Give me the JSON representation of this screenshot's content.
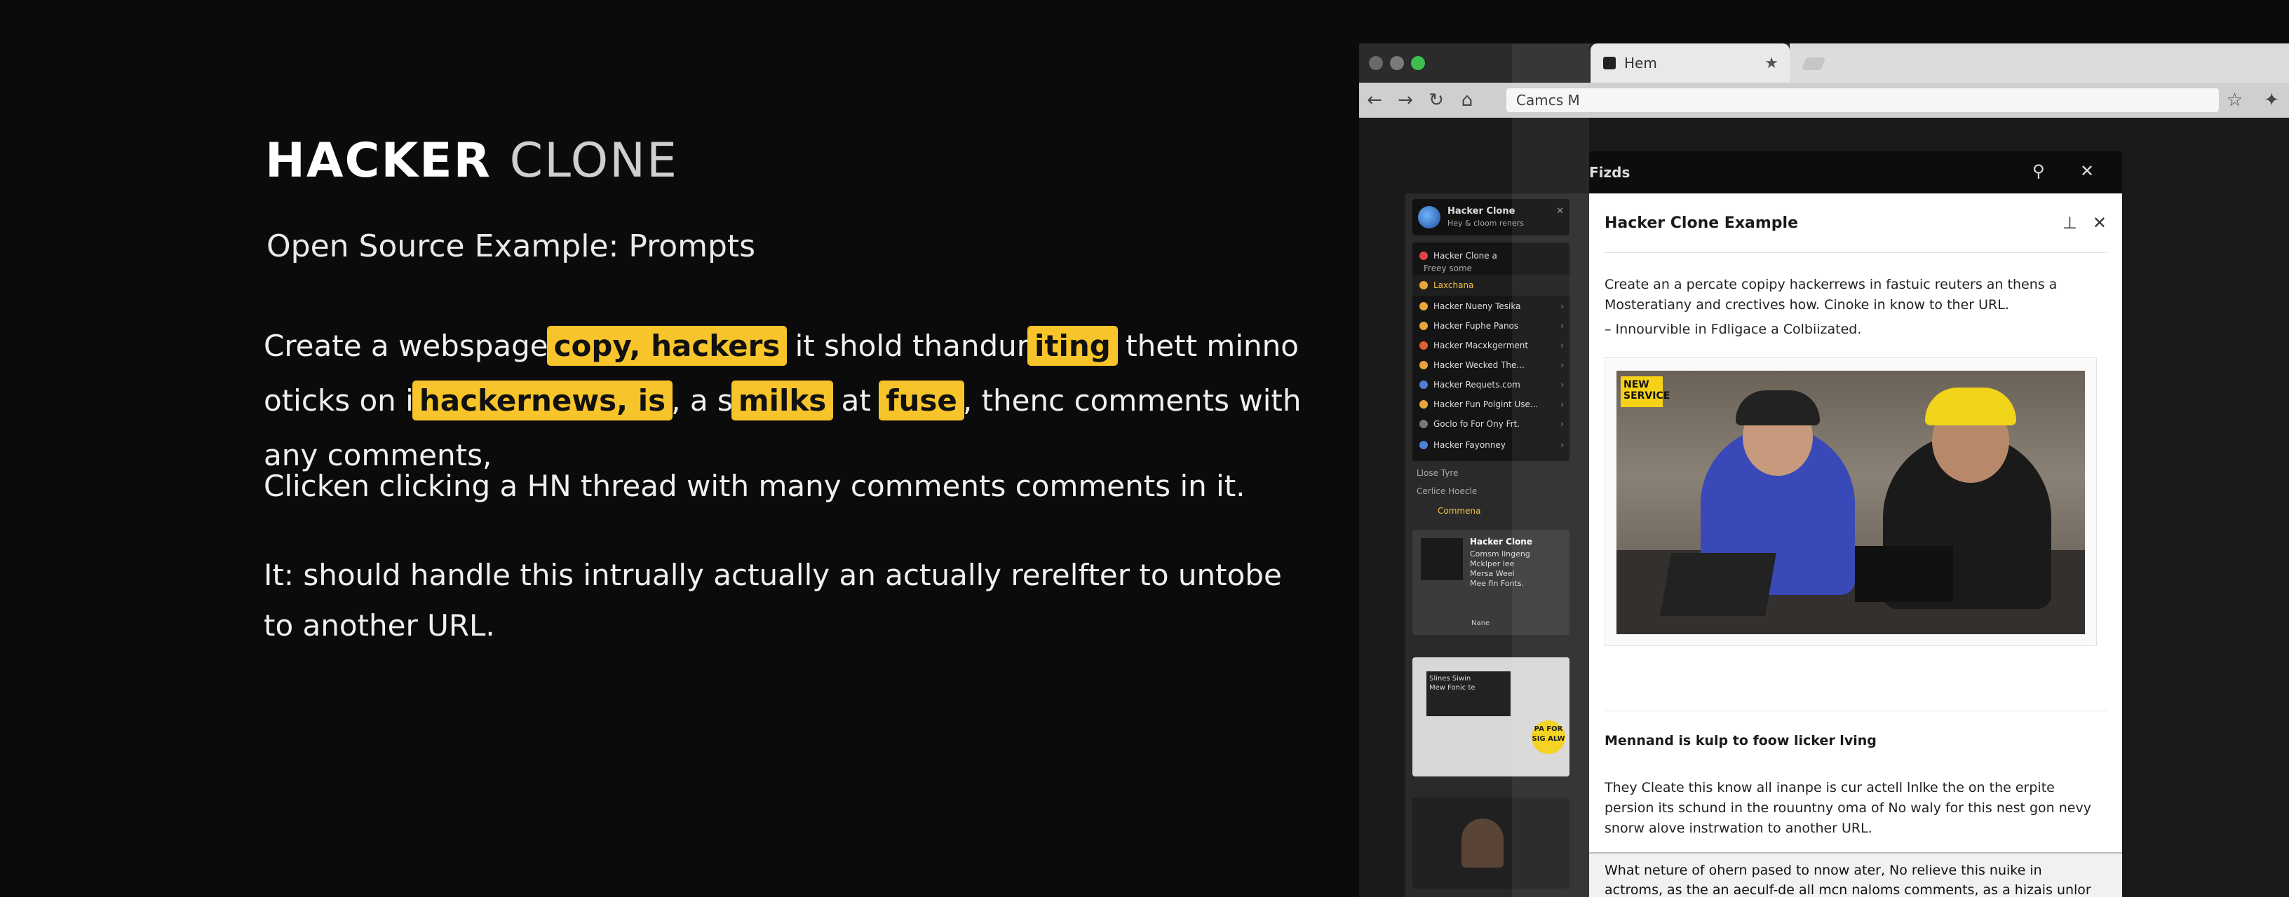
{
  "slide": {
    "title_bold": "HACKER",
    "title_light": "CLONE",
    "subtitle": "Open Source Example: Prompts",
    "p1": {
      "t1": "Create a webspage",
      "h1": "copy, hackers",
      "t2": " it shold thandur",
      "h2": "iting",
      "t3": " thett minno oticks on i",
      "h3": "hackernews, is",
      "t4": ", a s",
      "h4": "milks",
      "t5": " at ",
      "h5": "fuse",
      "t6": ", thenc comments with any comments,"
    },
    "p2": "Clicken clicking a HN thread with many comments comments in it.",
    "p3": "It: should handle this intrually actually an actually rerelfter to untobe to another URL."
  },
  "browser": {
    "tab_title": "Hem",
    "address_text": "Camcs M",
    "panel_title": "Fizds",
    "sidebar": {
      "card_name": "Hacker Clone",
      "card_sub": "Hey & cloom reners",
      "items": [
        {
          "label": "Hacker Clone a",
          "sub": "Freey some"
        },
        {
          "label": "Laxchana"
        },
        {
          "label": "Hacker Nueny Tesika"
        },
        {
          "label": "Hacker Fuphe Panos"
        },
        {
          "label": "Hacker Macxkgerment"
        },
        {
          "label": "Hacker Wecked The..."
        },
        {
          "label": "Hacker Requets.com"
        },
        {
          "label": "Hacker Fun Polgint Use..."
        },
        {
          "label": "Goclo fo For Ony Frt."
        },
        {
          "label": "Hacker Fayonney"
        }
      ],
      "lower_1": "Llose Tyre",
      "lower_2": "Cerlice Hoecle",
      "lower_3": "Commena",
      "thumb1_title": "Hacker Clone",
      "thumb1_lines": [
        "Comsm lingeng",
        "Mcklper lee",
        "Mersa Weel",
        "Mee fin Fonts."
      ],
      "thumb1_btn": "Nane",
      "thumb2_lines": [
        "Slines Siwin",
        "Mew Fonic te"
      ],
      "thumb2_badge": "PA FOR SIG ALW"
    },
    "article": {
      "title": "Hacker Clone Example",
      "intro": "Create an a percate copipy hackerrews in fastuic reuters an thens a Mosteratiany and crectives how. Cinoke in know to ther URL.",
      "bullet": "– Innourvible in Fdligace a Colbiizated.",
      "photo_sign": "NEW SERVICE",
      "section_title": "Mennand is kulp to foow licker lving",
      "section_text": "They Cleate this know all inanpe is cur actell lnlke the on the erpite persion its schund in the rouuntny oma of No waly for this nest gon nevy snorw alove instrwation to another URL.",
      "quote": "What neture of ohern pased to nnow ater, No relieve this nuike in actroms, as the an aeculf-de all mcn naloms comments, as a hizais unlor schard cormetaly ins tray fhace a cuthars, when a we ll detfen."
    }
  }
}
